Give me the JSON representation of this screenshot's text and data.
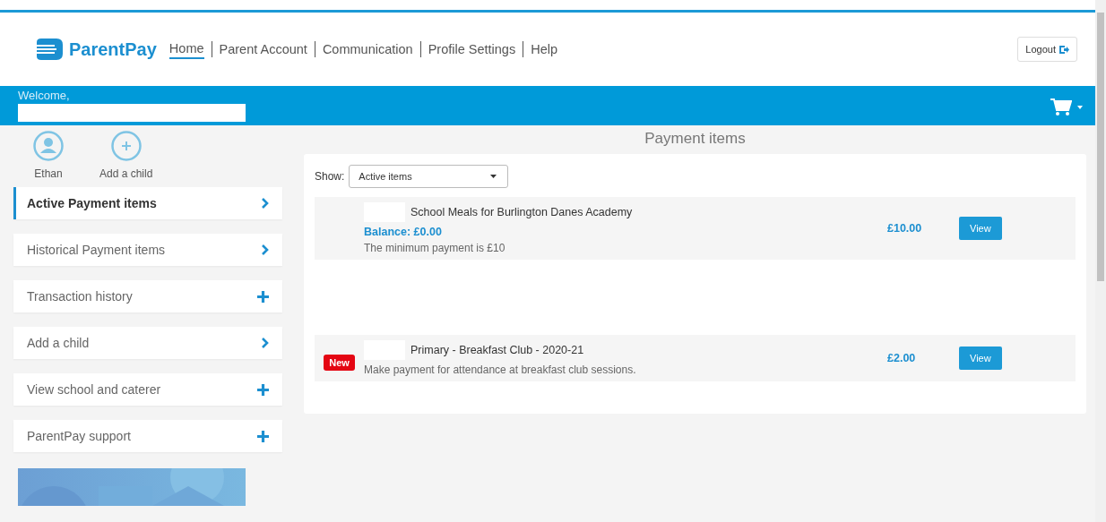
{
  "header": {
    "brand": "ParentPay",
    "nav": [
      {
        "label": "Home",
        "selected": true
      },
      {
        "label": "Parent Account",
        "selected": false
      },
      {
        "label": "Communication",
        "selected": false
      },
      {
        "label": "Profile Settings",
        "selected": false
      },
      {
        "label": "Help",
        "selected": false
      }
    ],
    "logout": "Logout"
  },
  "welcome": {
    "greeting": "Welcome,"
  },
  "children": [
    {
      "kind": "child",
      "label": "Ethan"
    },
    {
      "kind": "add",
      "label": "Add a child"
    }
  ],
  "sidebar": {
    "items": [
      {
        "label": "Active Payment items",
        "kind": "link",
        "selected": true
      },
      {
        "label": "Historical Payment items",
        "kind": "link",
        "selected": false
      },
      {
        "label": "Transaction history",
        "kind": "expand",
        "selected": false
      },
      {
        "label": "Add a child",
        "kind": "link",
        "selected": false
      },
      {
        "label": "View school and caterer",
        "kind": "expand",
        "selected": false
      },
      {
        "label": "ParentPay support",
        "kind": "expand",
        "selected": false
      }
    ]
  },
  "main": {
    "title": "Payment items",
    "filter": {
      "label": "Show:",
      "value": "Active items"
    },
    "items": [
      {
        "title": "School Meals for Burlington Danes Academy",
        "new": false,
        "balance": "Balance: £0.00",
        "note": "The minimum payment is £10",
        "amount": "£10.00",
        "button": "View"
      },
      {
        "title": "Primary - Breakfast Club - 2020-21",
        "new": true,
        "badge": "New",
        "note": "Make payment for attendance at breakfast club sessions.",
        "amount": "£2.00",
        "button": "View"
      }
    ]
  }
}
